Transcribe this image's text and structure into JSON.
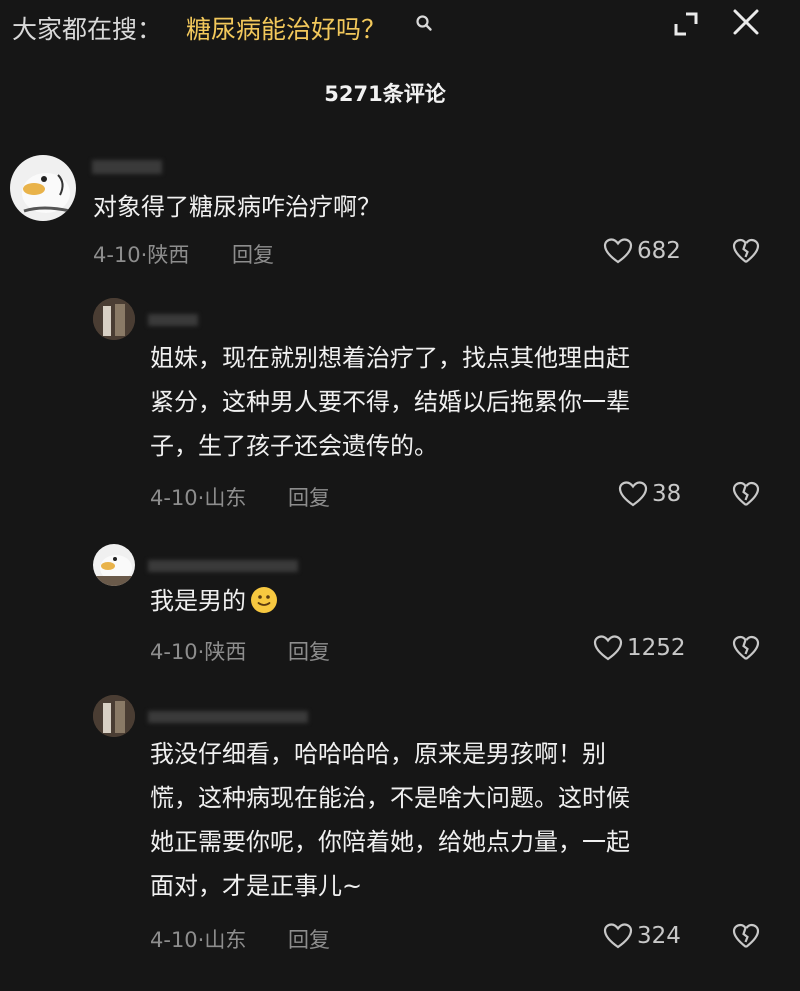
{
  "header": {
    "search_prefix": "大家都在搜：",
    "search_query": "糖尿病能治好吗？",
    "search_icon": "search-icon",
    "expand_icon": "expand-icon",
    "close_icon": "close-icon"
  },
  "comment_count": "5271条评论",
  "colors": {
    "background": "#161616",
    "search_highlight": "#f2c85b",
    "meta_text": "#8d8d8d"
  },
  "comments": [
    {
      "text_lines": [
        "对象得了糖尿病咋治疗啊？"
      ],
      "date_location": "4-10·陕西",
      "reply_label": "回复",
      "likes": "682"
    },
    {
      "text_lines": [
        "姐妹，现在就别想着治疗了，找点其他理由赶",
        "紧分，这种男人要不得，结婚以后拖累你一辈",
        "子，生了孩子还会遗传的。"
      ],
      "date_location": "4-10·山东",
      "reply_label": "回复",
      "likes": "38"
    },
    {
      "text_lines": [
        "我是男的"
      ],
      "emoji": "smiling-face-emoji",
      "date_location": "4-10·陕西",
      "reply_label": "回复",
      "likes": "1252"
    },
    {
      "text_lines": [
        "我没仔细看，哈哈哈哈，原来是男孩啊！别",
        "慌，这种病现在能治，不是啥大问题。这时候",
        "她正需要你呢，你陪着她，给她点力量，一起",
        "面对，才是正事儿~"
      ],
      "date_location": "4-10·山东",
      "reply_label": "回复",
      "likes": "324"
    }
  ]
}
